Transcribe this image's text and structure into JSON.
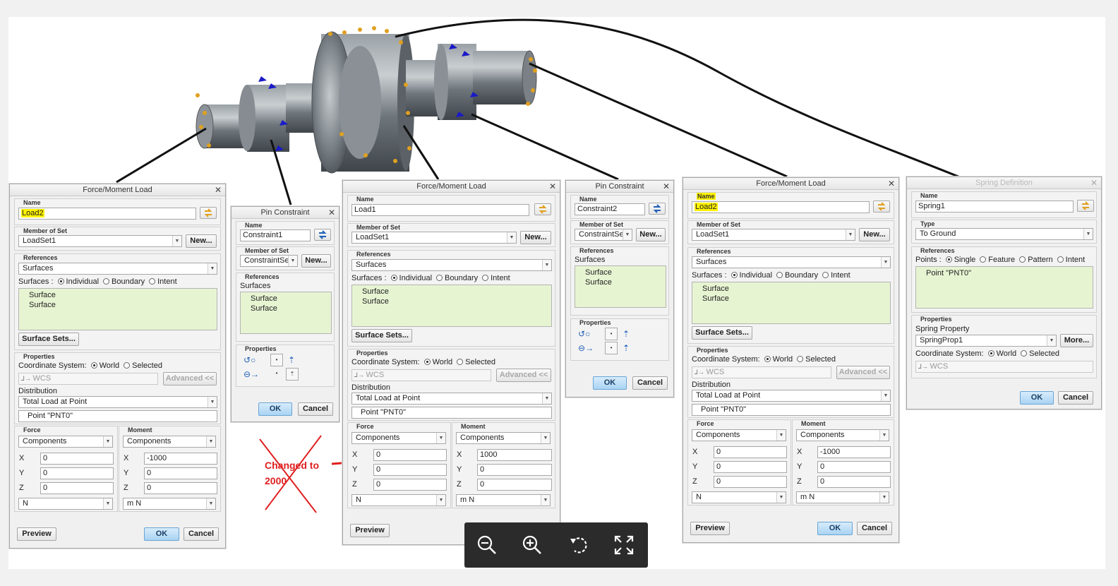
{
  "colors": {
    "highlight": "#fff200",
    "list_bg": "#e7f4d2",
    "ok_button": "#a9d3f3",
    "annotation_red": "#e02020",
    "model_grey": "#6d747a",
    "constraint_blue": "#1a1ac8",
    "load_orange": "#e0a020"
  },
  "annotation": {
    "text_line1": "Changed to",
    "text_line2": "2000"
  },
  "viewer": {
    "icons": [
      "zoom-out-icon",
      "zoom-in-icon",
      "rotate-icon",
      "fullscreen-icon"
    ]
  },
  "d1": {
    "title": "Force/Moment Load",
    "name_label": "Name",
    "name_value": "Load2",
    "member_label": "Member of Set",
    "member_value": "LoadSet1",
    "new_label": "New...",
    "refs_label": "References",
    "refs_value": "Surfaces",
    "surfaces_label": "Surfaces :",
    "opt_individual": "Individual",
    "opt_boundary": "Boundary",
    "opt_intent": "Intent",
    "items": [
      "Surface",
      "Surface"
    ],
    "surface_sets": "Surface Sets...",
    "props_label": "Properties",
    "cs_label": "Coordinate System:",
    "opt_world": "World",
    "opt_selected": "Selected",
    "wcs": "WCS",
    "advanced": "Advanced <<",
    "dist_label": "Distribution",
    "dist_value": "Total Load at Point",
    "point_value": "Point \"PNT0\"",
    "force_label": "Force",
    "moment_label": "Moment",
    "force_type": "Components",
    "moment_type": "Components",
    "fx": "0",
    "fy": "0",
    "fz": "0",
    "mx": "-1000",
    "my": "0",
    "mz": "0",
    "force_unit": "N",
    "moment_unit": "m N",
    "preview": "Preview",
    "ok": "OK",
    "cancel": "Cancel"
  },
  "d2": {
    "title": "Pin Constraint",
    "name_label": "Name",
    "name_value": "Constraint1",
    "member_label": "Member of Set",
    "member_value": "ConstraintSe",
    "new_label": "New...",
    "refs_label": "References",
    "refs_sub": "Surfaces",
    "items": [
      "Surface",
      "Surface"
    ],
    "props_label": "Properties",
    "ok": "OK",
    "cancel": "Cancel"
  },
  "d3": {
    "title": "Force/Moment Load",
    "name_label": "Name",
    "name_value": "Load1",
    "member_label": "Member of Set",
    "member_value": "LoadSet1",
    "new_label": "New...",
    "refs_label": "References",
    "refs_value": "Surfaces",
    "surfaces_label": "Surfaces :",
    "opt_individual": "Individual",
    "opt_boundary": "Boundary",
    "opt_intent": "Intent",
    "items": [
      "Surface",
      "Surface"
    ],
    "surface_sets": "Surface Sets...",
    "props_label": "Properties",
    "cs_label": "Coordinate System:",
    "opt_world": "World",
    "opt_selected": "Selected",
    "wcs": "WCS",
    "advanced": "Advanced <<",
    "dist_label": "Distribution",
    "dist_value": "Total Load at Point",
    "point_value": "Point \"PNT0\"",
    "force_label": "Force",
    "moment_label": "Moment",
    "force_type": "Components",
    "moment_type": "Components",
    "fx": "0",
    "fy": "0",
    "fz": "0",
    "mx": "1000",
    "my": "0",
    "mz": "0",
    "force_unit": "N",
    "moment_unit": "m N",
    "preview": "Preview"
  },
  "d4": {
    "title": "Pin Constraint",
    "name_label": "Name",
    "name_value": "Constraint2",
    "member_label": "Member of Set",
    "member_value": "ConstraintSe",
    "new_label": "New...",
    "refs_label": "References",
    "refs_sub": "Surfaces",
    "items": [
      "Surface",
      "Surface"
    ],
    "props_label": "Properties",
    "ok": "OK",
    "cancel": "Cancel"
  },
  "d5": {
    "title": "Force/Moment Load",
    "name_label": "Name",
    "name_value": "Load2",
    "member_label": "Member of Set",
    "member_value": "LoadSet1",
    "new_label": "New...",
    "refs_label": "References",
    "refs_value": "Surfaces",
    "surfaces_label": "Surfaces :",
    "opt_individual": "Individual",
    "opt_boundary": "Boundary",
    "opt_intent": "Intent",
    "items": [
      "Surface",
      "Surface"
    ],
    "surface_sets": "Surface Sets...",
    "props_label": "Properties",
    "cs_label": "Coordinate System:",
    "opt_world": "World",
    "opt_selected": "Selected",
    "wcs": "WCS",
    "advanced": "Advanced <<",
    "dist_label": "Distribution",
    "dist_value": "Total Load at Point",
    "point_value": "Point \"PNT0\"",
    "force_label": "Force",
    "moment_label": "Moment",
    "force_type": "Components",
    "moment_type": "Components",
    "fx": "0",
    "fy": "0",
    "fz": "0",
    "mx": "-1000",
    "my": "0",
    "mz": "0",
    "force_unit": "N",
    "moment_unit": "m N",
    "preview": "Preview",
    "ok": "OK",
    "cancel": "Cancel"
  },
  "d6": {
    "title": "Spring Definition",
    "name_label": "Name",
    "name_value": "Spring1",
    "type_label": "Type",
    "type_value": "To Ground",
    "refs_label": "References",
    "points_label": "Points :",
    "opt_single": "Single",
    "opt_feature": "Feature",
    "opt_pattern": "Pattern",
    "opt_intent": "Intent",
    "point_item": "Point \"PNT0\"",
    "props_label": "Properties",
    "spring_prop_label": "Spring Property",
    "spring_prop_value": "SpringProp1",
    "more": "More...",
    "cs_label": "Coordinate System:",
    "opt_world": "World",
    "opt_selected": "Selected",
    "wcs": "WCS",
    "ok": "OK",
    "cancel": "Cancel"
  },
  "axis": {
    "x": "X",
    "y": "Y",
    "z": "Z"
  }
}
